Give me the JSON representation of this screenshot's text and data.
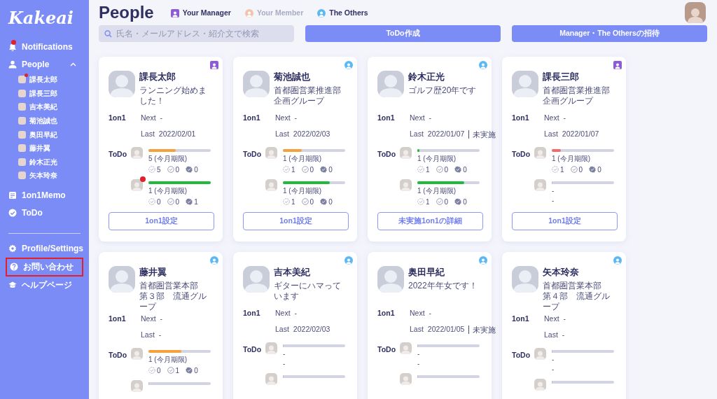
{
  "sidebar": {
    "logo": "Kakeai",
    "items": [
      {
        "kind": "notifications",
        "label": "Notifications",
        "badge": true
      },
      {
        "kind": "people",
        "label": "People",
        "expanded": true,
        "children": [
          {
            "label": "課長太郎",
            "badge": true
          },
          {
            "label": "課長三郎",
            "badge": false
          },
          {
            "label": "吉本美紀",
            "badge": false
          },
          {
            "label": "菊池誠也",
            "badge": false
          },
          {
            "label": "奥田早紀",
            "badge": false
          },
          {
            "label": "藤井翼",
            "badge": false
          },
          {
            "label": "鈴木正光",
            "badge": false
          },
          {
            "label": "矢本玲奈",
            "badge": false
          }
        ]
      },
      {
        "kind": "memo",
        "label": "1on1Memo"
      },
      {
        "kind": "todo",
        "label": "ToDo"
      },
      {
        "kind": "divider"
      },
      {
        "kind": "settings",
        "label": "Profile/Settings"
      },
      {
        "kind": "help",
        "label": "お問い合わせ",
        "highlighted": true
      },
      {
        "kind": "guide",
        "label": "ヘルプページ"
      }
    ]
  },
  "header": {
    "title": "People",
    "legend": [
      {
        "label": "Your Manager",
        "color": "#8e5bd6",
        "disabled": false
      },
      {
        "label": "Your Member",
        "color": "#f3c3b0",
        "disabled": true
      },
      {
        "label": "The Others",
        "color": "#5ab8f5",
        "disabled": false
      }
    ]
  },
  "toolbar": {
    "search": {
      "placeholder": "氏名・メールアドレス・紹介文で検索"
    },
    "buttons": [
      "ToDo作成",
      "Manager・The Othersの招待"
    ]
  },
  "cards": [
    {
      "name": "課長太郎",
      "kind": "manager",
      "bio": [
        "ランニング始めました！"
      ],
      "oneonone": {
        "label": "1on1",
        "next": {
          "label": "Next",
          "value": "-"
        },
        "last": {
          "label": "Last",
          "value": "2022/02/01"
        }
      },
      "todo": {
        "label": "ToDo",
        "items": [
          {
            "level": 0.44,
            "color": "#f5a23c",
            "unread": false,
            "lines": [
              "5 (今月期限)"
            ],
            "stats": [
              "5",
              "0",
              "0"
            ]
          },
          {
            "level": 1,
            "color": "#22b83a",
            "unread": true,
            "lines": [
              "1 (今月期限)"
            ],
            "stats": [
              "0",
              "0",
              "1"
            ]
          }
        ]
      },
      "button": "1on1設定"
    },
    {
      "name": "菊池誠也",
      "kind": "other",
      "bio": [
        "首都圏営業推進部",
        "企画グループ"
      ],
      "oneonone": {
        "label": "1on1",
        "next": {
          "label": "Next",
          "value": "-"
        },
        "last": {
          "label": "Last",
          "value": "2022/02/03"
        }
      },
      "todo": {
        "label": "ToDo",
        "items": [
          {
            "level": 0.3,
            "color": "#f5a23c",
            "unread": false,
            "lines": [
              "1 (今月期限)"
            ],
            "stats": [
              "1",
              "0",
              "0"
            ]
          },
          {
            "level": 0.75,
            "color": "#22b83a",
            "unread": false,
            "lines": [
              "1 (今月期限)"
            ],
            "stats": [
              "1",
              "0",
              "0"
            ]
          }
        ]
      },
      "button": "1on1設定"
    },
    {
      "name": "鈴木正光",
      "kind": "other",
      "bio": [
        "ゴルフ歴20年です"
      ],
      "oneonone": {
        "label": "1on1",
        "next": {
          "label": "Next",
          "value": "-"
        },
        "last": {
          "label": "Last",
          "value": "2022/01/07",
          "note": "未実施"
        }
      },
      "todo": {
        "label": "ToDo",
        "items": [
          {
            "level": 0.03,
            "color": "#22b83a",
            "unread": false,
            "lines": [
              "1 (今月期限)"
            ],
            "stats": [
              "1",
              "0",
              "0"
            ]
          },
          {
            "level": 0.75,
            "color": "#22b83a",
            "unread": false,
            "lines": [
              "1 (今月期限)"
            ],
            "stats": [
              "1",
              "0",
              "0"
            ]
          }
        ]
      },
      "button": "未実施1on1の詳細"
    },
    {
      "name": "課長三郎",
      "kind": "manager",
      "bio": [
        "首都圏営業推進部",
        "企画グループ"
      ],
      "oneonone": {
        "label": "1on1",
        "next": {
          "label": "Next",
          "value": "-"
        },
        "last": {
          "label": "Last",
          "value": "2022/01/07"
        }
      },
      "todo": {
        "label": "ToDo",
        "items": [
          {
            "level": 0.15,
            "color": "#f26b6b",
            "unread": false,
            "lines": [
              "1 (今月期限)"
            ],
            "stats": [
              "1",
              "0",
              "0"
            ]
          },
          {
            "level": 0,
            "unread": false,
            "lines": [
              "-",
              "-"
            ]
          }
        ]
      },
      "button": "1on1設定"
    },
    {
      "name": "藤井翼",
      "kind": "other",
      "bio": [
        "首都圏営業本部",
        "第３部　流通グループ"
      ],
      "oneonone": {
        "label": "1on1",
        "next": {
          "label": "Next",
          "value": "-"
        },
        "last": {
          "label": "Last",
          "value": "-"
        }
      },
      "todo": {
        "label": "ToDo",
        "items": [
          {
            "level": 0.53,
            "color": "#f5a23c",
            "unread": false,
            "lines": [
              "1 (今月期限)"
            ],
            "stats": [
              "0",
              "1",
              "0"
            ]
          },
          {
            "level": 0,
            "unread": false
          }
        ]
      }
    },
    {
      "name": "吉本美紀",
      "kind": "other",
      "bio": [
        "ギターにハマっています"
      ],
      "oneonone": {
        "label": "1on1",
        "next": {
          "label": "Next",
          "value": "-"
        },
        "last": {
          "label": "Last",
          "value": "2022/02/03"
        }
      },
      "todo": {
        "label": "ToDo",
        "items": [
          {
            "level": 0,
            "unread": false,
            "lines": [
              "-",
              "-"
            ]
          },
          {
            "level": 0,
            "unread": false
          }
        ]
      }
    },
    {
      "name": "奥田早紀",
      "kind": "other",
      "bio": [
        "2022年年女です！"
      ],
      "oneonone": {
        "label": "1on1",
        "next": {
          "label": "Next",
          "value": "-"
        },
        "last": {
          "label": "Last",
          "value": "2022/01/05",
          "note": "未実施"
        }
      },
      "todo": {
        "label": "ToDo",
        "items": [
          {
            "level": 0,
            "unread": false,
            "lines": [
              "-",
              "-"
            ]
          },
          {
            "level": 0,
            "unread": false
          }
        ]
      }
    },
    {
      "name": "矢本玲奈",
      "kind": "other",
      "bio": [
        "首都圏営業本部",
        "第４部　流通グループ"
      ],
      "oneonone": {
        "label": "1on1",
        "next": {
          "label": "Next",
          "value": "-"
        },
        "last": {
          "label": "Last",
          "value": "-"
        }
      },
      "todo": {
        "label": "ToDo",
        "items": [
          {
            "level": 0,
            "unread": false,
            "lines": [
              "-",
              "-"
            ]
          },
          {
            "level": 0,
            "unread": false
          }
        ]
      }
    }
  ]
}
